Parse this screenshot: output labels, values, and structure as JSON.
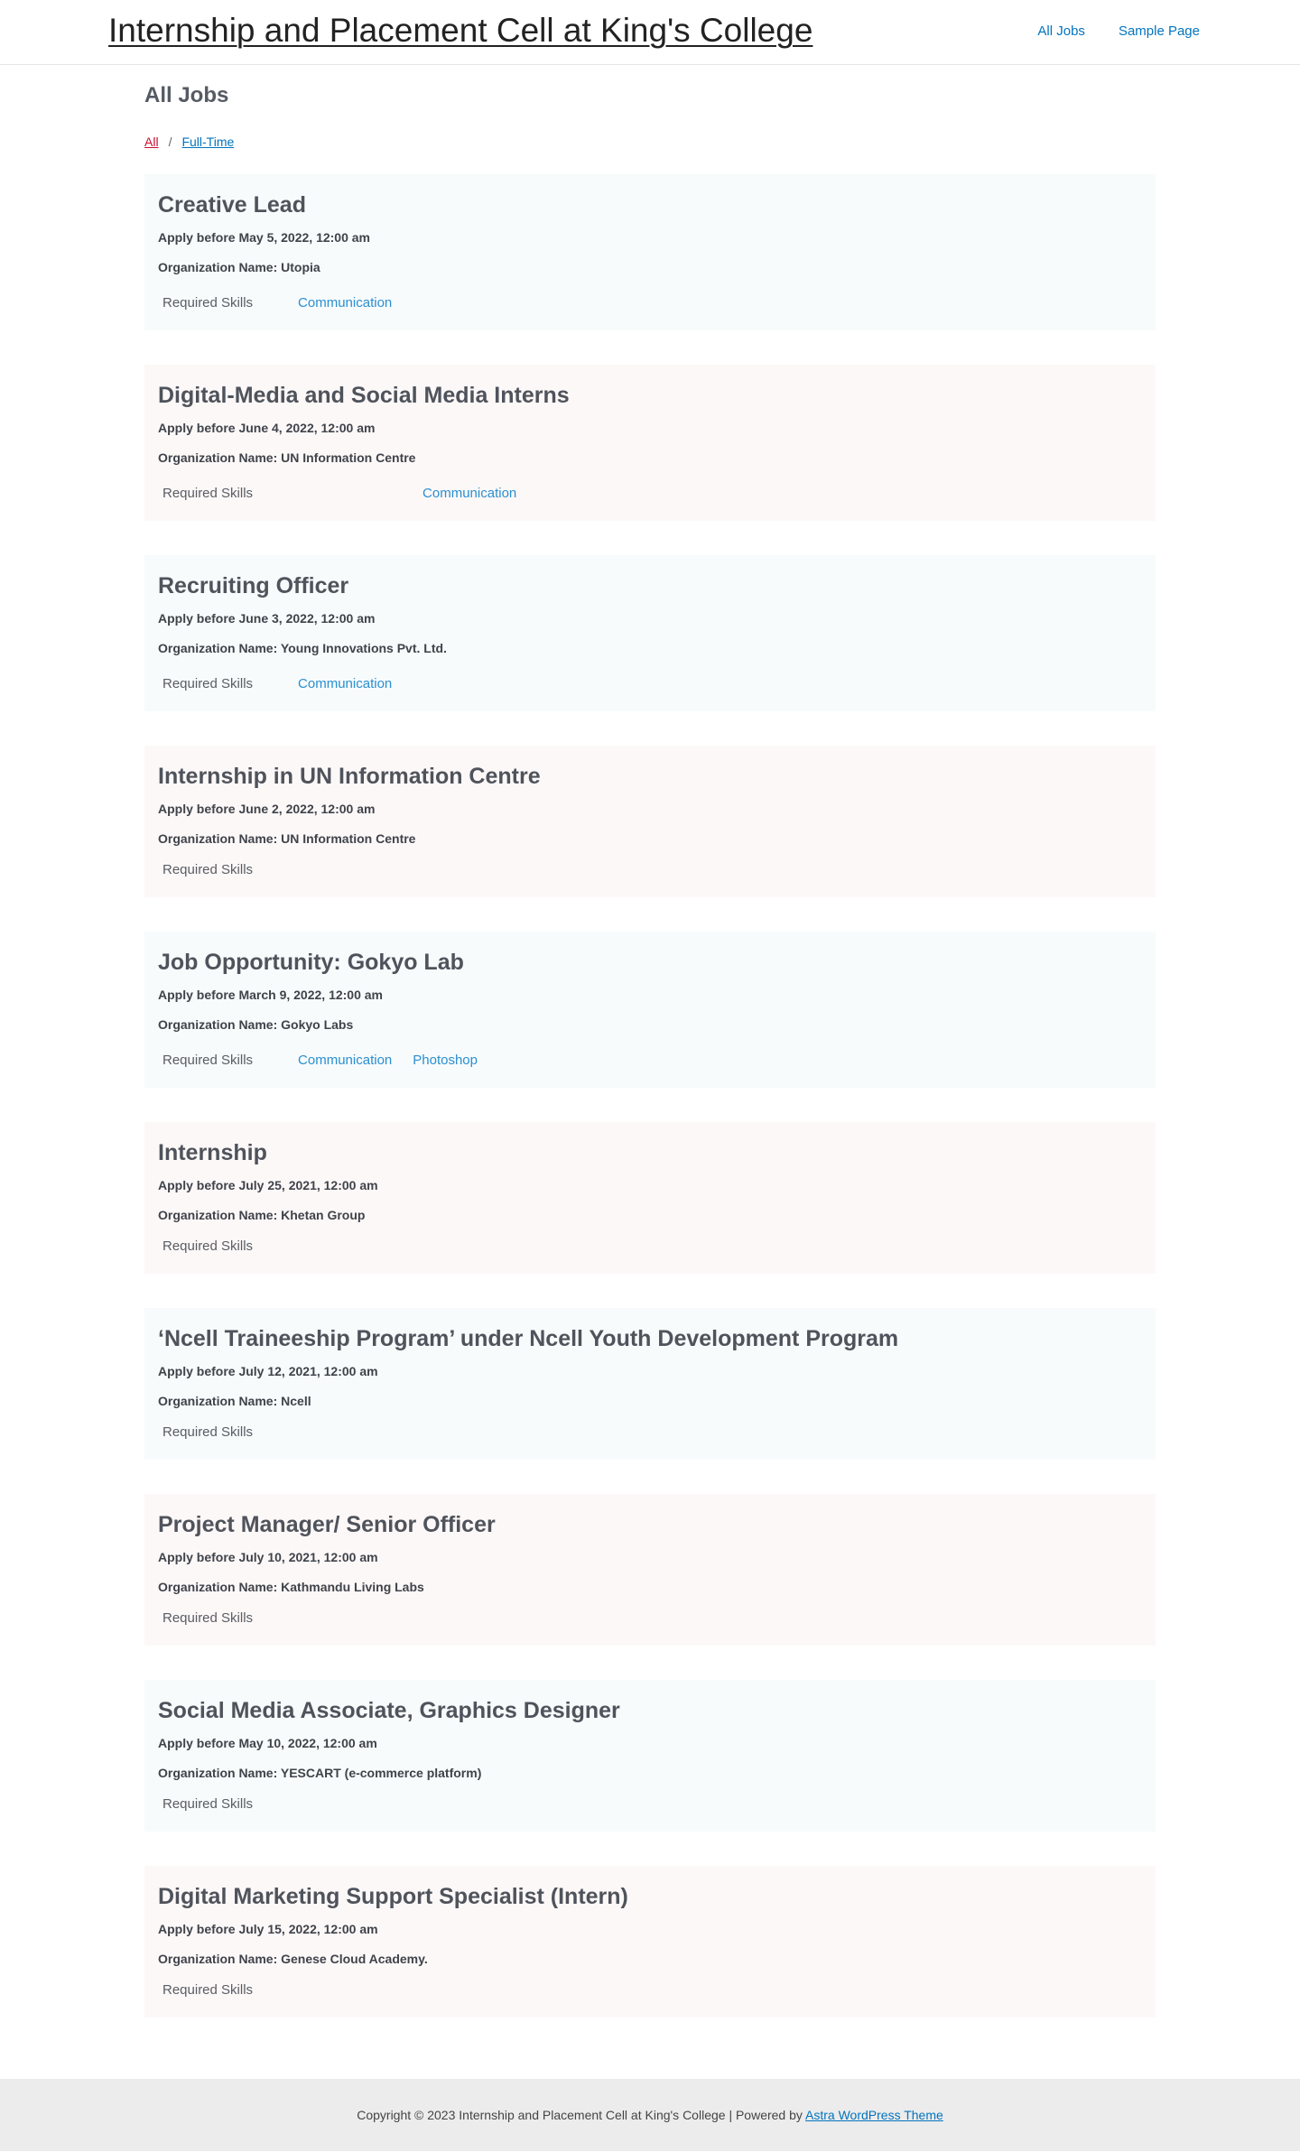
{
  "header": {
    "site_title": "Internship and Placement Cell at King's College",
    "nav": [
      {
        "label": "All Jobs"
      },
      {
        "label": "Sample Page"
      }
    ]
  },
  "page": {
    "heading": "All Jobs",
    "filters": {
      "all": "All",
      "separator": "/",
      "full_time": "Full-Time"
    }
  },
  "skills_label": "Required Skills",
  "jobs": [
    {
      "title": "Creative Lead",
      "apply": "Apply before May 5, 2022, 12:00 am",
      "org": "Organization Name: Utopia",
      "skills": [
        "Communication"
      ]
    },
    {
      "title": "Digital-Media and Social Media Interns",
      "apply": "Apply before June 4, 2022, 12:00 am",
      "org": "Organization Name: UN Information Centre",
      "skills": [
        "Communication"
      ]
    },
    {
      "title": "Recruiting Officer",
      "apply": "Apply before June 3, 2022, 12:00 am",
      "org": "Organization Name: Young Innovations Pvt. Ltd.",
      "skills": [
        "Communication"
      ]
    },
    {
      "title": "Internship in UN Information Centre",
      "apply": "Apply before June 2, 2022, 12:00 am",
      "org": "Organization Name: UN Information Centre",
      "skills": []
    },
    {
      "title": "Job Opportunity: Gokyo Lab",
      "apply": "Apply before March 9, 2022, 12:00 am",
      "org": "Organization Name: Gokyo Labs",
      "skills": [
        "Communication",
        "Photoshop"
      ]
    },
    {
      "title": "Internship",
      "apply": "Apply before July 25, 2021, 12:00 am",
      "org": "Organization Name: Khetan Group",
      "skills": []
    },
    {
      "title": "‘Ncell Traineeship Program’ under Ncell Youth Development Program",
      "apply": "Apply before July 12, 2021, 12:00 am",
      "org": "Organization Name: Ncell",
      "skills": []
    },
    {
      "title": "Project Manager/ Senior Officer",
      "apply": "Apply before July 10, 2021, 12:00 am",
      "org": "Organization Name: Kathmandu Living Labs",
      "skills": []
    },
    {
      "title": "Social Media Associate, Graphics Designer",
      "apply": "Apply before May 10, 2022, 12:00 am",
      "org": "Organization Name: YESCART (e-commerce platform)",
      "skills": []
    },
    {
      "title": "Digital Marketing Support Specialist (Intern)",
      "apply": "Apply before July 15, 2022, 12:00 am",
      "org": "Organization Name: Genese Cloud Academy.",
      "skills": []
    }
  ],
  "footer": {
    "text": "Copyright © 2023 Internship and Placement Cell at King's College | Powered by ",
    "link_label": "Astra WordPress Theme"
  },
  "colors": {
    "card_blue": "#f7fbfc",
    "card_pink": "#fdf8f8",
    "link": "#0274be",
    "active_filter": "#c8102e"
  }
}
